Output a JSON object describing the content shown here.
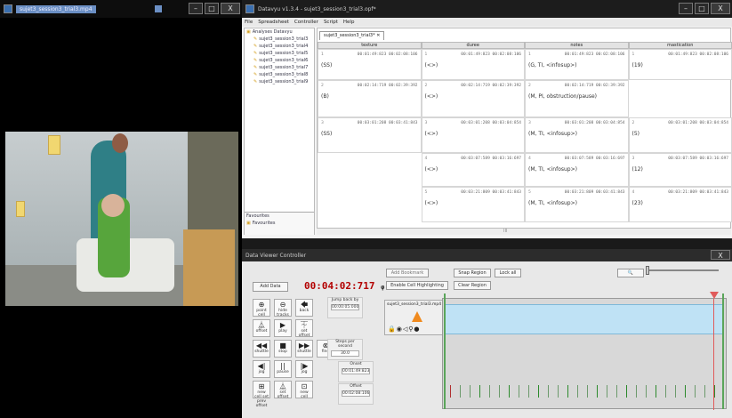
{
  "video_window": {
    "title": "sujet3_session3_trial3.mp4",
    "min": "–",
    "max": "□",
    "close": "X"
  },
  "datavyu": {
    "title": "Datavyu v1.3.4 - sujet3_session3_trial3.opf*",
    "menu": [
      "File",
      "Spreadsheet",
      "Controller",
      "Script",
      "Help"
    ],
    "tree_root": "Analyses Datavyu",
    "tree_items": [
      "sujet3_session3_trial3",
      "sujet3_session3_trial4",
      "sujet3_session3_trial5",
      "sujet3_session3_trial6",
      "sujet3_session3_trial7",
      "sujet3_session3_trial8",
      "sujet3_session3_trial9"
    ],
    "favourites_header": "Favourites",
    "favourites_item": "Favourites",
    "tab_label": "sujet3_session3_trial3*",
    "tab_close": "✕",
    "columns": [
      "texture",
      "duree",
      "notes",
      "mastication"
    ],
    "rows": [
      {
        "texture": {
          "ord": "1",
          "ts": "00:01:49:823  00:02:08:106",
          "val": "(SS)"
        },
        "duree": {
          "ord": "1",
          "ts": "00:01:49:823  00:02:08:106",
          "val": "(<>)"
        },
        "notes": {
          "ord": "1",
          "ts": "00:01:49:823  00:02:08:106",
          "val": "(G, TI, <infosup>)"
        },
        "mastication": {
          "ord": "1",
          "ts": "00:01:49:823  00:02:08:106",
          "val": "(19)"
        }
      },
      {
        "texture": {
          "ord": "2",
          "ts": "00:02:14:719  00:02:39:392",
          "val": "(B)"
        },
        "duree": {
          "ord": "2",
          "ts": "00:02:14:719  00:02:39:392",
          "val": "(<>)"
        },
        "notes": {
          "ord": "2",
          "ts": "00:02:14:719  00:02:39:392",
          "val": "(M, PI, obstruction/pause)"
        },
        "mastication": null
      },
      {
        "texture": {
          "ord": "3",
          "ts": "00:03:01:208  00:03:41:843",
          "val": "(SS)"
        },
        "duree": {
          "ord": "3",
          "ts": "00:03:01:208  00:03:04:854",
          "val": "(<>)"
        },
        "notes": {
          "ord": "3",
          "ts": "00:03:01:208  00:03:04:854",
          "val": "(M, TI, <infosup>)"
        },
        "mastication": {
          "ord": "2",
          "ts": "00:03:01:208  00:03:04:854",
          "val": "(5)"
        }
      },
      {
        "texture": null,
        "duree": {
          "ord": "4",
          "ts": "00:03:07:589  00:03:16:697",
          "val": "(<>)"
        },
        "notes": {
          "ord": "4",
          "ts": "00:03:07:589  00:03:16:697",
          "val": "(M, TI, <infosup>)"
        },
        "mastication": {
          "ord": "3",
          "ts": "00:03:07:589  00:03:16:697",
          "val": "(12)"
        }
      },
      {
        "texture": null,
        "duree": {
          "ord": "5",
          "ts": "00:03:21:809  00:03:41:843",
          "val": "(<>)"
        },
        "notes": {
          "ord": "5",
          "ts": "00:03:21:809  00:03:41:843",
          "val": "(M, TI, <infosup>)"
        },
        "mastication": {
          "ord": "4",
          "ts": "00:03:21:809  00:03:41:843",
          "val": "(23)"
        }
      }
    ],
    "scroll_mark": "III"
  },
  "controller": {
    "title": "Data Viewer Controller",
    "add_data": "Add Data",
    "timer_h": "00:",
    "timer_rest": "04:02:717",
    "timer_suffix": "φ 0x",
    "buttons": {
      "add_bookmark": "Add Bookmark",
      "snap_region": "Snap Region",
      "lock_all": "Lock all",
      "enable_cell_highlighting": "Enable Cell Highlighting",
      "clear_region": "Clear Region"
    },
    "pad": [
      {
        "g": "⊕",
        "l": "point cell"
      },
      {
        "g": "⊖",
        "l": "hide tracks"
      },
      {
        "g": "🡄",
        "l": "back"
      },
      {
        "g": "⏅",
        "l": "offset"
      },
      {
        "g": "▶",
        "l": "play"
      },
      {
        "g": "⏇",
        "l": "set offset"
      },
      {
        "g": "◀◀",
        "l": "shuttle"
      },
      {
        "g": "■",
        "l": "stop"
      },
      {
        "g": "▶▶",
        "l": "shuttle"
      },
      {
        "g": "◀|",
        "l": "jog"
      },
      {
        "g": "||",
        "l": "pause"
      },
      {
        "g": "|▶",
        "l": "jog"
      },
      {
        "g": "⊞",
        "l": "new cell set prev offset"
      },
      {
        "g": "⏅",
        "l": "set offset"
      },
      {
        "g": "⊡",
        "l": "new cell"
      },
      {
        "g": "⊗",
        "l": "find"
      }
    ],
    "jump_back_label": "Jump back by",
    "jump_back_value": "00:00:05:000",
    "steps_label": "Steps per second",
    "steps_value": "30.0",
    "onset_label": "Onset",
    "onset_value": "00:01:49:823",
    "offset_label": "Offset",
    "offset_value": "00:02:08:106",
    "track_file": "sujet3_session3_trial3.mp4",
    "search_label": "🔍"
  }
}
